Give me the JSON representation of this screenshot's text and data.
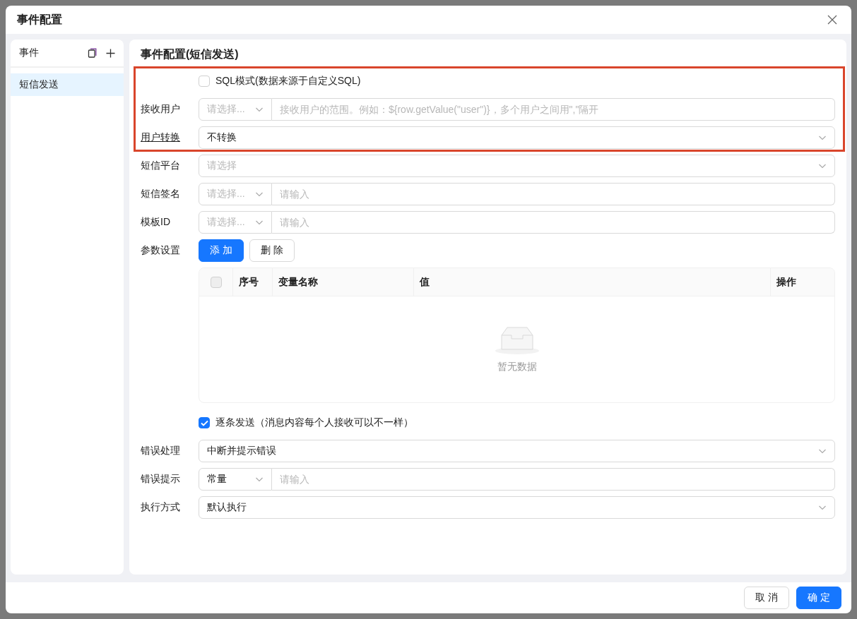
{
  "dialog": {
    "title": "事件配置"
  },
  "sidebar": {
    "title": "事件",
    "items": [
      {
        "label": "短信发送",
        "selected": true
      }
    ]
  },
  "panel_title": "事件配置(短信发送)",
  "highlight_group": {
    "fields": [
      {
        "kind": "checkbox",
        "text": "SQL模式(数据来源于自定义SQL)",
        "checked": false
      },
      {
        "kind": "combo",
        "label": "接收用户",
        "select": {
          "placeholder": "请选择..."
        },
        "input": {
          "placeholder": "接收用户的范围。例如：${row.getValue(\"user\")}，多个用户之间用\",\"隔开"
        }
      },
      {
        "kind": "select",
        "label": "用户转换",
        "label_link": true,
        "value": "不转换"
      }
    ]
  },
  "fields": [
    {
      "kind": "select",
      "label": "短信平台",
      "placeholder": "请选择"
    },
    {
      "kind": "combo",
      "label": "短信签名",
      "select": {
        "placeholder": "请选择..."
      },
      "input": {
        "placeholder": "请输入"
      }
    },
    {
      "kind": "combo",
      "label": "模板ID",
      "select": {
        "placeholder": "请选择..."
      },
      "input": {
        "placeholder": "请输入"
      }
    },
    {
      "kind": "buttons",
      "label": "参数设置",
      "buttons": [
        {
          "label": "添 加",
          "kind": "primary"
        },
        {
          "label": "删 除",
          "kind": "default"
        }
      ]
    },
    {
      "kind": "table",
      "select_all": {
        "checked": false
      },
      "columns": [
        "序号",
        "变量名称",
        "值",
        "操作"
      ],
      "empty_text": "暂无数据"
    },
    {
      "kind": "checkbox",
      "text": "逐条发送（消息内容每个人接收可以不一样）",
      "checked": true
    },
    {
      "kind": "select",
      "label": "错误处理",
      "value": "中断并提示错误"
    },
    {
      "kind": "combo",
      "label": "错误提示",
      "select": {
        "value": "常量"
      },
      "input": {
        "placeholder": "请输入"
      }
    },
    {
      "kind": "select",
      "label": "执行方式",
      "value": "默认执行"
    }
  ],
  "footer": {
    "buttons": [
      {
        "label": "取 消",
        "kind": "default"
      },
      {
        "label": "确 定",
        "kind": "primary"
      }
    ]
  }
}
